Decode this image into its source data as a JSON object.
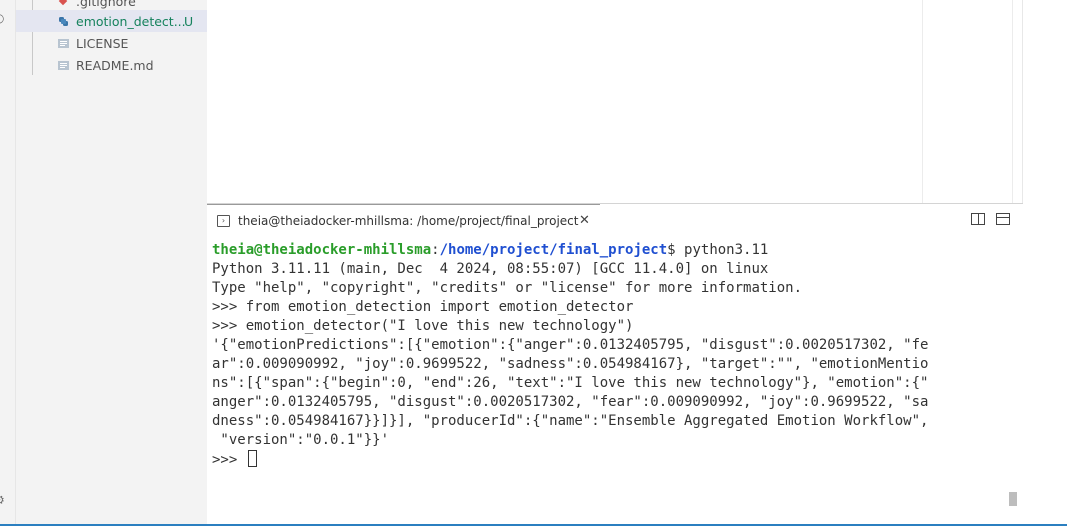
{
  "explorer": {
    "items": [
      {
        "name": ".gitignore",
        "icon": "git-diamond-icon",
        "status": "",
        "selected": false
      },
      {
        "name": "emotion_detect...",
        "icon": "python-icon",
        "status": "U",
        "selected": true
      },
      {
        "name": "LICENSE",
        "icon": "file-lines-icon",
        "status": "",
        "selected": false
      },
      {
        "name": "README.md",
        "icon": "file-lines-icon",
        "status": "",
        "selected": false
      }
    ]
  },
  "terminal": {
    "tab_title": "theia@theiadocker-mhillsma: /home/project/final_project",
    "prompt_user": "theia@theiadocker-mhillsma",
    "prompt_sep": ":",
    "prompt_path": "/home/project/final_project",
    "prompt_cmd": "$ python3.11",
    "lines": [
      "Python 3.11.11 (main, Dec  4 2024, 08:55:07) [GCC 11.4.0] on linux",
      "Type \"help\", \"copyright\", \"credits\" or \"license\" for more information.",
      ">>> from emotion_detection import emotion_detector",
      ">>> emotion_detector(\"I love this new technology\")",
      "'{\"emotionPredictions\":[{\"emotion\":{\"anger\":0.0132405795, \"disgust\":0.0020517302, \"fe",
      "ar\":0.009090992, \"joy\":0.9699522, \"sadness\":0.054984167}, \"target\":\"\", \"emotionMentio",
      "ns\":[{\"span\":{\"begin\":0, \"end\":26, \"text\":\"I love this new technology\"}, \"emotion\":{\"",
      "anger\":0.0132405795, \"disgust\":0.0020517302, \"fear\":0.009090992, \"joy\":0.9699522, \"sa",
      "dness\":0.054984167}}]}], \"producerId\":{\"name\":\"Ensemble Aggregated Emotion Workflow\",",
      " \"version\":\"0.0.1\"}}'"
    ],
    "final_prompt": ">>> "
  },
  "colors": {
    "accent": "#2b7fc0",
    "untracked": "#16825d",
    "prompt_user": "#2a9d2a",
    "prompt_path": "#1f4fd1"
  }
}
